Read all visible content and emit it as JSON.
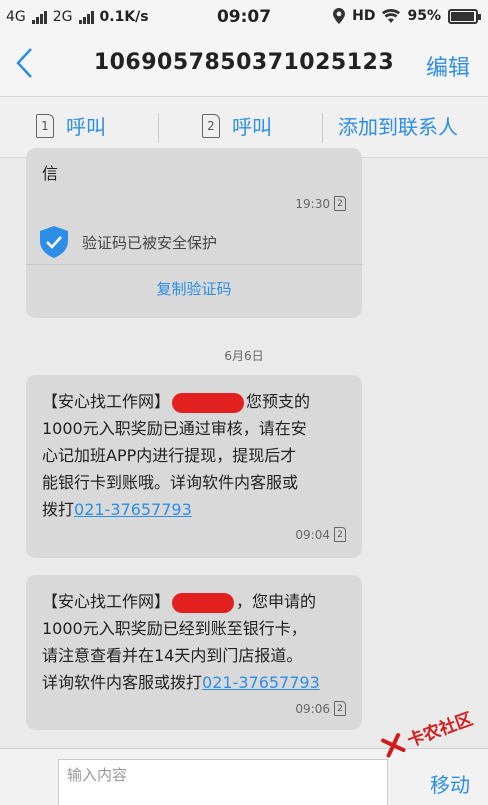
{
  "status_bar": {
    "network_left": "4G",
    "network_right": "2G",
    "speed": "0.1K/s",
    "time": "09:07",
    "hd": "HD",
    "battery": "95%"
  },
  "header": {
    "title": "1069057850371025123",
    "edit_label": "编辑"
  },
  "actions": {
    "call1_sim": "1",
    "call1_label": "呼叫",
    "call2_sim": "2",
    "call2_label": "呼叫",
    "add_contact_label": "添加到联系人"
  },
  "messages": [
    {
      "partial_text": "信",
      "time": "19:30",
      "sim": "2",
      "protect_text": "验证码已被安全保护",
      "copy_code_label": "复制验证码"
    },
    {
      "line1_a": "【安心找工作网】",
      "line1_b": "您预支的",
      "line2": "1000元入职奖励已通过审核，请在安",
      "line3": "心记加班APP内进行提现，提现后才",
      "line4": "能银行卡到账哦。详询软件内客服或",
      "line5_a": "拨打",
      "phone": "021-37657793",
      "time": "09:04",
      "sim": "2"
    },
    {
      "line1_a": "【安心找工作网】",
      "line1_b": "，您申请的",
      "line2": "1000元入职奖励已经到账至银行卡，",
      "line3": "请注意查看并在14天内到门店报道。",
      "line4_a": "详询软件内客服或拨打",
      "phone": "021-37657793",
      "time": "09:06",
      "sim": "2"
    }
  ],
  "date_separator": "6月6日",
  "input": {
    "placeholder": "输入内容",
    "send_label": "移动"
  },
  "watermark": {
    "text": "卡农社区"
  },
  "colors": {
    "accent": "#2c8ee6",
    "bubble": "#d9d9d9",
    "redaction": "#e32020"
  }
}
